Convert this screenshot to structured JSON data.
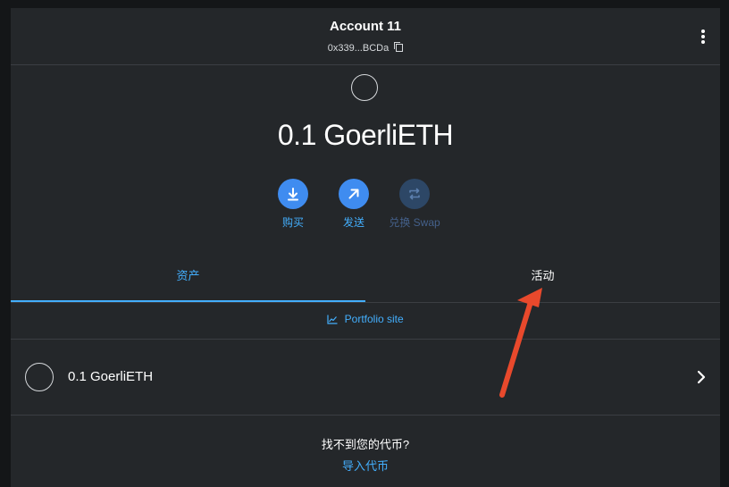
{
  "header": {
    "account_name": "Account 11",
    "address": "0x339...BCDa",
    "copy_icon": "copy-icon",
    "menu_icon": "kebab-menu-icon"
  },
  "balance": {
    "amount_text": "0.1 GoerliETH"
  },
  "actions": [
    {
      "label": "购买",
      "icon": "download-icon",
      "enabled": true
    },
    {
      "label": "发送",
      "icon": "arrow-up-right-icon",
      "enabled": true
    },
    {
      "label": "兑换 Swap",
      "icon": "swap-icon",
      "enabled": false
    }
  ],
  "tabs": [
    {
      "label": "资产",
      "active": true
    },
    {
      "label": "活动",
      "active": false
    }
  ],
  "portfolio": {
    "label": "Portfolio site",
    "icon": "chart-icon"
  },
  "assets": [
    {
      "label": "0.1 GoerliETH"
    }
  ],
  "footer": {
    "not_found_text": "找不到您的代币?",
    "import_link": "导入代币"
  },
  "colors": {
    "accent": "#43aefc",
    "button_blue": "#3f8cf0",
    "annotation_arrow": "#e8492c",
    "panel_bg": "#24272a"
  }
}
